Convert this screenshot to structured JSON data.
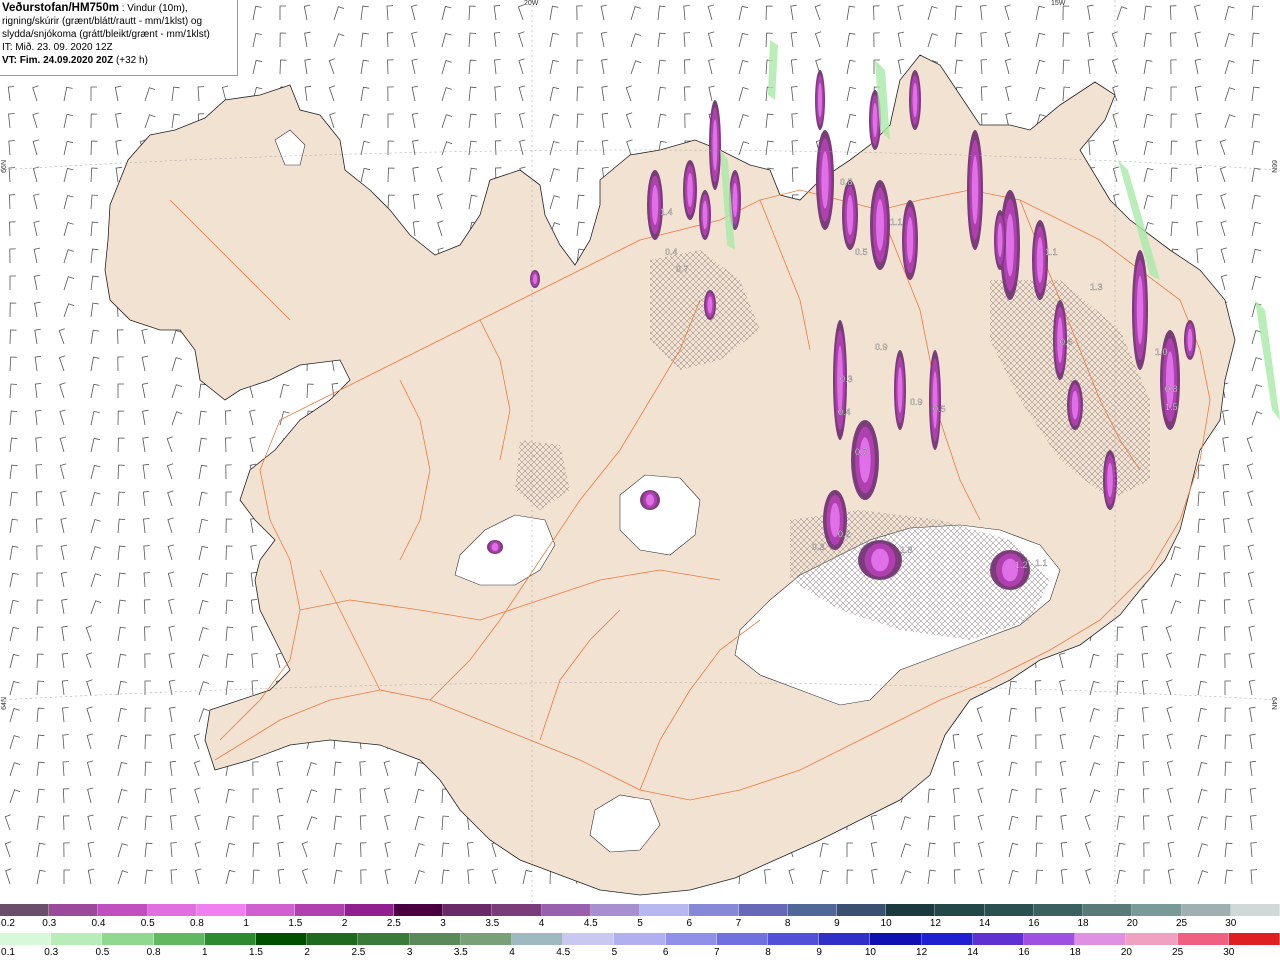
{
  "info": {
    "title": "Veðurstofan/HM750m",
    "line1_rest": " : Vindur (10m),",
    "line2": "rigning/skúrir (grænt/blátt/rautt - mm/1klst) og",
    "line3": "slydda/snjókoma (grátt/bleikt/grænt - mm/1klst)",
    "line4": "IT: Mið. 23. 09. 2020 12Z",
    "line5": "VT: Fim. 24.09.2020 20Z",
    "line5_rest": " (+32 h)"
  },
  "grid_labels": {
    "lon_20w": "20W",
    "lon_15w": "15W",
    "lat_66n_left": "66N",
    "lat_66n_right": "66N",
    "lat_64n_left": "64N",
    "lat_64n_right": "64N"
  },
  "colors": {
    "land": "#f2e2d2",
    "roads": "#f07a42",
    "sea": "#ffffff",
    "glacier": "#ffffff",
    "snow_dark": "#7a3d7a",
    "snow_mid": "#b040b0",
    "snow_bright": "#e070e8",
    "rain_light": "#a8eaa8"
  },
  "snow_scale": {
    "labels": [
      "0.2",
      "0.3",
      "0.4",
      "0.5",
      "0.8",
      "1",
      "1.5",
      "2",
      "2.5",
      "3",
      "3.5",
      "4",
      "4.5",
      "5",
      "6",
      "7",
      "8",
      "9",
      "10",
      "12",
      "14",
      "16",
      "18",
      "20",
      "25",
      "30"
    ],
    "colors": [
      "#6b4e6b",
      "#9b4a9b",
      "#c050c0",
      "#e070e0",
      "#f080f0",
      "#d060d0",
      "#b040b0",
      "#901f90",
      "#4a0040",
      "#6a2a6a",
      "#7a3d7a",
      "#9a60b0",
      "#a890d0",
      "#b8b8f0",
      "#8888d8",
      "#6868b8",
      "#506898",
      "#3a5070",
      "#1a3a40",
      "#224848",
      "#2a5050",
      "#3a6060",
      "#5a7a7a",
      "#7a9a9a",
      "#a0b0b0",
      "#d0d8d8"
    ]
  },
  "rain_scale": {
    "labels": [
      "0.1",
      "0.3",
      "0.5",
      "0.8",
      "1",
      "1.5",
      "2",
      "2.5",
      "3",
      "3.5",
      "4",
      "4.5",
      "5",
      "6",
      "7",
      "8",
      "9",
      "10",
      "12",
      "14",
      "16",
      "18",
      "20",
      "25",
      "30"
    ],
    "colors": [
      "#d8f8d8",
      "#b8ecb8",
      "#90d890",
      "#60b860",
      "#2e8a2e",
      "#005000",
      "#1e6a1e",
      "#3a7a3a",
      "#5a8a5a",
      "#7aa07a",
      "#a0b8c0",
      "#c8c8f0",
      "#b0b0f0",
      "#9090e8",
      "#7070e0",
      "#5050d8",
      "#3030c8",
      "#1010b0",
      "#2020d0",
      "#6030d0",
      "#a050e0",
      "#e090e0",
      "#f0a0c0",
      "#f06080",
      "#e02020"
    ]
  },
  "snow_values": [
    "1.4",
    "0.7",
    "0.4",
    "0.8",
    "0.5",
    "1.1",
    "0.9",
    "0.3",
    "0.4",
    "0.7",
    "0.3",
    "0.8",
    "1.5",
    "1.8",
    "1.2",
    "1.1",
    "0.2",
    "0.5",
    "1.3",
    "0.6",
    "0.9",
    "1.1",
    "1.0"
  ]
}
